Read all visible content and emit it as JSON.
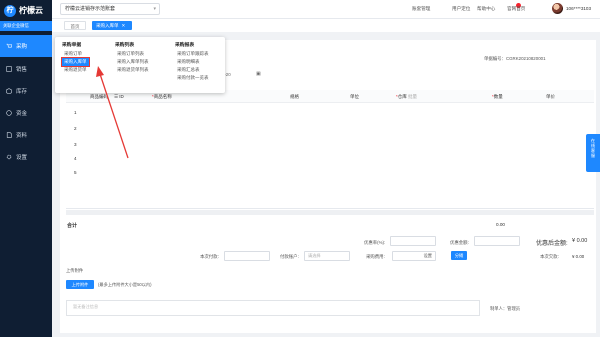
{
  "app": {
    "logo_text": "柠檬云",
    "logo_glyph": "柠"
  },
  "sidebar": {
    "top_tag": "关联企业微信",
    "items": [
      {
        "label": "采购",
        "icon": "cart-icon",
        "active": true
      },
      {
        "label": "销售",
        "icon": "tag-icon",
        "active": false
      },
      {
        "label": "库存",
        "icon": "box-icon",
        "active": false
      },
      {
        "label": "资金",
        "icon": "wallet-icon",
        "active": false
      },
      {
        "label": "资料",
        "icon": "doc-icon",
        "active": false
      },
      {
        "label": "设置",
        "icon": "gear-icon",
        "active": false
      }
    ]
  },
  "header": {
    "company": "柠檬云进销存示范账套",
    "links": [
      "账套管理",
      "用户定位",
      "帮助中心",
      "官网首页"
    ],
    "user": "106****3103"
  },
  "tabs": {
    "home": "首页",
    "current": "采购入库单"
  },
  "menu": {
    "col1": {
      "title": "采购单据",
      "items": [
        "采购订单",
        "采购入库单",
        "采购退货单"
      ]
    },
    "col2": {
      "title": "采购列表",
      "items": [
        "采购订单列表",
        "采购入库单列表",
        "采购退货单列表"
      ]
    },
    "col3": {
      "title": "采购报表",
      "items": [
        "采购订单跟踪表",
        "采购明细表",
        "采购汇总表",
        "采购付款一览表"
      ]
    }
  },
  "form": {
    "doc_no_label": "单据编号：",
    "doc_no": "CGRK20210820001",
    "date_value": "-08-20"
  },
  "grid": {
    "headers": [
      "商品编码",
      "商品名称",
      "规格",
      "单位",
      "仓库",
      "数量",
      "单价"
    ],
    "id_header": "ID",
    "warehouse_placeholder": "批量",
    "rows": [
      "1",
      "2",
      "3",
      "4",
      "5"
    ]
  },
  "totals": {
    "label": "合计",
    "value": "0.00"
  },
  "footer": {
    "discount_rate_label": "优惠率(%):",
    "discount_amount_label": "优惠金额:",
    "after_discount_label": "优惠后金额:",
    "after_discount_value": "¥ 0.00",
    "pay_now_label": "本次付款:",
    "pay_account_label": "付款账户:",
    "pay_account_placeholder": "请选择",
    "purchase_cost_label": "采购费用:",
    "cost_btn": "设置",
    "fill_btn": "分摊",
    "debt_label": "本次欠款:",
    "debt_value": "¥ 0.00",
    "attach_label": "上传附件",
    "upload_btn": "上传附件",
    "upload_tip": "(最多上传附件大小是50以内)",
    "remark_placeholder": "暂无备注信息",
    "maker": "制单人：管理员"
  },
  "online_help": "在线客服"
}
